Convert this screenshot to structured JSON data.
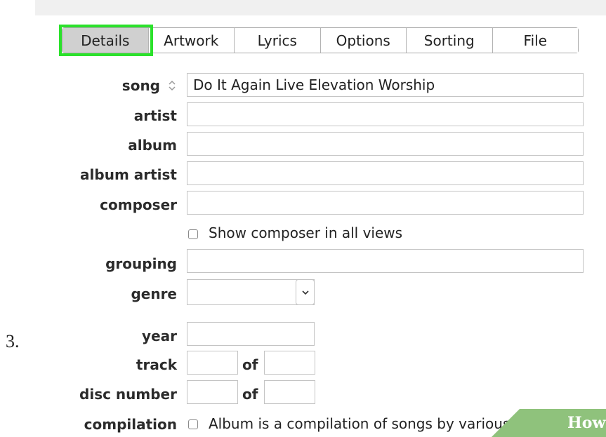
{
  "step_number": "3.",
  "tabs": [
    {
      "label": "Details",
      "selected": true
    },
    {
      "label": "Artwork",
      "selected": false
    },
    {
      "label": "Lyrics",
      "selected": false
    },
    {
      "label": "Options",
      "selected": false
    },
    {
      "label": "Sorting",
      "selected": false
    },
    {
      "label": "File",
      "selected": false
    }
  ],
  "highlight_color": "#2be12b",
  "fields": {
    "song": {
      "label": "song",
      "value": "Do It Again Live Elevation Worship"
    },
    "artist": {
      "label": "artist",
      "value": ""
    },
    "album": {
      "label": "album",
      "value": ""
    },
    "album_artist": {
      "label": "album artist",
      "value": ""
    },
    "composer": {
      "label": "composer",
      "value": ""
    },
    "show_composer": {
      "label": "Show composer in all views",
      "checked": false
    },
    "grouping": {
      "label": "grouping",
      "value": ""
    },
    "genre": {
      "label": "genre",
      "value": ""
    },
    "year": {
      "label": "year",
      "value": ""
    },
    "track": {
      "label": "track",
      "of_label": "of",
      "value": "",
      "total": ""
    },
    "disc": {
      "label": "disc number",
      "of_label": "of",
      "value": "",
      "total": ""
    },
    "compilation": {
      "label": "compilation",
      "checkbox_label": "Album is a compilation of songs by various artists",
      "checked": false
    }
  },
  "watermark": {
    "text": "How"
  },
  "icons": {
    "sort": "sort-arrows-icon",
    "dropdown": "chevron-down-icon"
  }
}
